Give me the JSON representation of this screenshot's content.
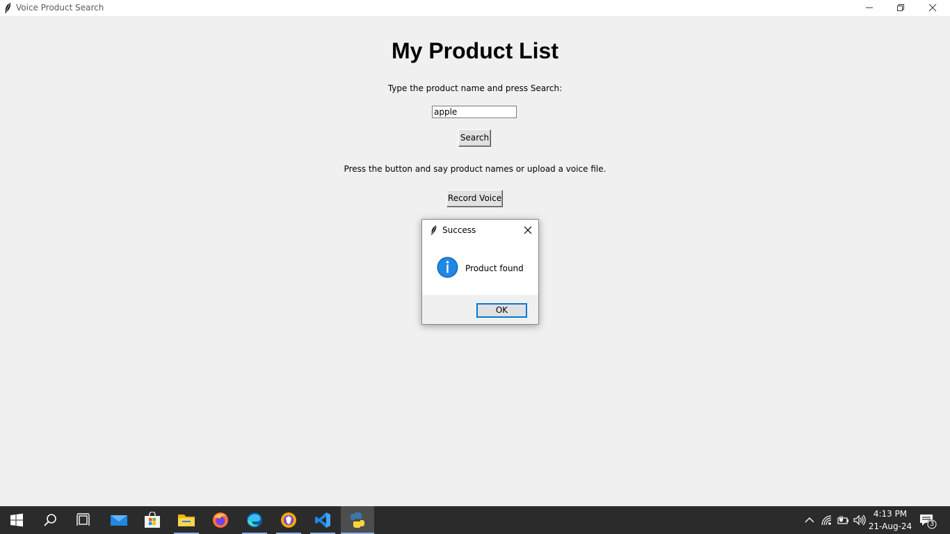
{
  "window": {
    "title": "Voice Product Search",
    "icon": "feather-icon",
    "controls": [
      "minimize-icon",
      "maximize-icon",
      "close-icon"
    ]
  },
  "main": {
    "heading": "My Product List",
    "search_prompt": "Type the product name and press Search:",
    "search_value": "apple",
    "search_button": "Search",
    "voice_prompt": "Press the button and say product names or upload a voice file.",
    "record_button": "Record Voice"
  },
  "dialog": {
    "title": "Success",
    "icon": "info-icon",
    "message": "Product found",
    "ok_button": "OK"
  },
  "taskbar": {
    "apps": [
      "start-icon",
      "search-icon",
      "task-view-icon",
      "mail-icon",
      "store-icon",
      "file-explorer-icon",
      "firefox-icon",
      "edge-icon",
      "brave-icon",
      "vscode-icon",
      "python-icon"
    ],
    "tray": [
      "chevron-up-icon",
      "network-icon",
      "battery-icon",
      "volume-icon"
    ],
    "time": "4:13 PM",
    "date": "21-Aug-24",
    "notification_count": "3"
  },
  "colors": {
    "background": "#f0f0f0",
    "taskbar": "#2b2b2b",
    "accent": "#0078d7"
  }
}
